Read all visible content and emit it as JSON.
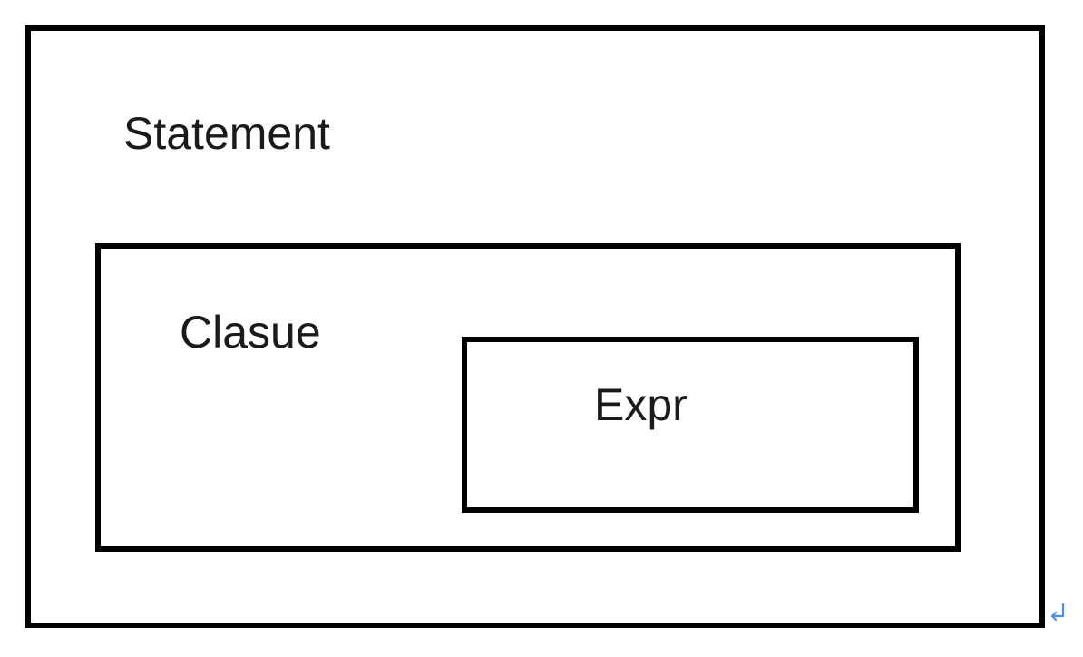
{
  "diagram": {
    "outer": {
      "label": "Statement"
    },
    "middle": {
      "label": "Clasue"
    },
    "inner": {
      "label": "Expr"
    }
  },
  "colors": {
    "border": "#000000",
    "text": "#1a1a1a",
    "background": "#ffffff",
    "return_mark": "#4a90e2"
  },
  "icons": {
    "return_mark": "return-arrow-icon"
  }
}
